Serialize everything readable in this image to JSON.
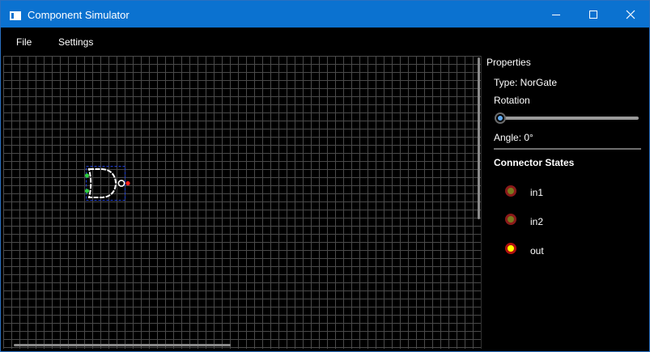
{
  "window": {
    "title": "Component Simulator",
    "icon": "app-window-icon"
  },
  "window_controls": [
    "minimize-icon",
    "maximize-icon",
    "close-icon"
  ],
  "menu": {
    "items": [
      "File",
      "Settings"
    ]
  },
  "canvas": {
    "component": {
      "type": "NorGate",
      "inputs": [
        "in1",
        "in2"
      ],
      "output": "out",
      "selected": true
    }
  },
  "properties": {
    "header": "Properties",
    "type_line": "Type: NorGate",
    "rotation_label": "Rotation",
    "rotation_value": 0,
    "angle_line": "Angle: 0°",
    "connector_states_title": "Connector States",
    "connectors": [
      {
        "name": "in1",
        "state": "low",
        "fill": "#7a7a1e",
        "ring": "#8b1a1a"
      },
      {
        "name": "in2",
        "state": "low",
        "fill": "#7a7a1e",
        "ring": "#8b1a1a"
      },
      {
        "name": "out",
        "state": "high",
        "fill": "#ffff00",
        "ring": "#b01010"
      }
    ]
  },
  "colors": {
    "titlebar": "#0b72d0",
    "grid": "#4a4a4a",
    "gate_outline": "#ffffff",
    "selection": "#1f3fd6",
    "input_pin": "#2ecc40",
    "output_pin": "#ff2020",
    "slider_accent": "#60aaf0"
  }
}
